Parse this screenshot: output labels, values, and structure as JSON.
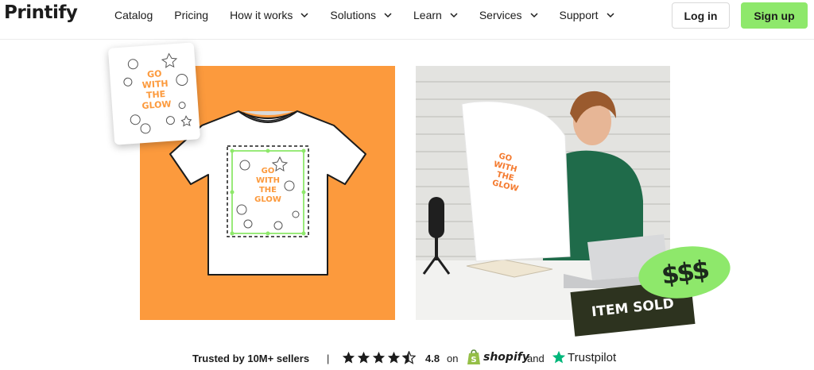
{
  "brand": {
    "logo_text": "Printify"
  },
  "nav": {
    "items": [
      {
        "label": "Catalog",
        "has_dropdown": false
      },
      {
        "label": "Pricing",
        "has_dropdown": false
      },
      {
        "label": "How it works",
        "has_dropdown": true
      },
      {
        "label": "Solutions",
        "has_dropdown": true
      },
      {
        "label": "Learn",
        "has_dropdown": true
      },
      {
        "label": "Services",
        "has_dropdown": true
      },
      {
        "label": "Support",
        "has_dropdown": true
      }
    ],
    "login_label": "Log in",
    "signup_label": "Sign up"
  },
  "hero": {
    "design_text": "GO WITH THE GLOW",
    "sticker_money": "$$$",
    "sticker_sold": "ITEM SOLD"
  },
  "trust": {
    "trusted_text": "Trusted by 10M+ sellers",
    "separator": "|",
    "rating": "4.8",
    "rating_value": 4.5,
    "on_word": "on",
    "shopify_label": "shopify",
    "and_word": "and",
    "trustpilot_label": "Trustpilot"
  },
  "colors": {
    "accent_green": "#8ee86b",
    "orange": "#fc9a3d",
    "dark_olive": "#2d331f",
    "text": "#1c1c1c",
    "trustpilot_green": "#00b67a",
    "shopify_green": "#95bf47"
  }
}
